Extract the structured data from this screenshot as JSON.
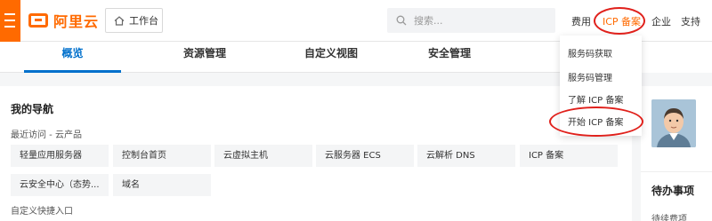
{
  "brand": {
    "name": "阿里云",
    "color": "#ff6a00"
  },
  "header": {
    "workbench_label": "工作台",
    "search_placeholder": "搜索...",
    "nav": {
      "fee": "费用",
      "icp": "ICP 备案",
      "enterprise": "企业",
      "support": "支持"
    }
  },
  "tabs": [
    {
      "label": "概览",
      "active": true
    },
    {
      "label": "资源管理",
      "active": false
    },
    {
      "label": "自定义视图",
      "active": false
    },
    {
      "label": "安全管理",
      "active": false
    }
  ],
  "my_nav": {
    "title": "我的导航",
    "recent_label": "最近访问 - 云产品",
    "recent_row1": [
      "轻量应用服务器",
      "控制台首页",
      "云虚拟主机",
      "云服务器 ECS",
      "云解析 DNS",
      "ICP 备案"
    ],
    "recent_row2": [
      "云安全中心（态势...",
      "域名"
    ],
    "custom_label": "自定义快捷入口"
  },
  "todo": {
    "title": "待办事项",
    "item": "待续费项"
  },
  "dropdown": {
    "items": [
      "服务码获取",
      "服务码管理",
      "了解 ICP 备案",
      "开始 ICP 备案"
    ]
  },
  "colors": {
    "accent": "#0070cc",
    "annotation": "#e0201b"
  }
}
